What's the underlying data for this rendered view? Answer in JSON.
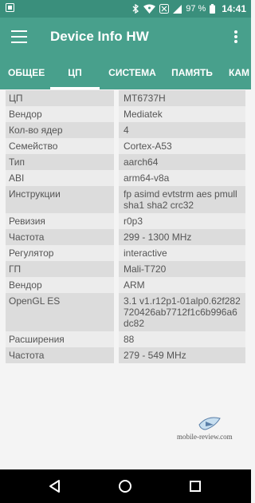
{
  "status_bar": {
    "battery_percent": "97 %",
    "time": "14:41",
    "icons": [
      "notification-icon",
      "bluetooth-icon",
      "wifi-icon",
      "data-off-icon",
      "signal-icon",
      "battery-icon"
    ]
  },
  "app_bar": {
    "title": "Device Info HW",
    "menu_icon": "hamburger-menu-icon",
    "overflow_icon": "more-vertical-icon"
  },
  "tabs": [
    {
      "label": "ОБЩЕЕ",
      "active": false
    },
    {
      "label": "ЦП",
      "active": true
    },
    {
      "label": "СИСТЕМА",
      "active": false
    },
    {
      "label": "ПАМЯТЬ",
      "active": false
    },
    {
      "label": "КАМ",
      "active": false
    }
  ],
  "rows": [
    {
      "key": "ЦП",
      "value": "MT6737H"
    },
    {
      "key": "Вендор",
      "value": "Mediatek"
    },
    {
      "key": "Кол-во ядер",
      "value": "4"
    },
    {
      "key": "Семейство",
      "value": "Cortex-A53"
    },
    {
      "key": "Тип",
      "value": "aarch64"
    },
    {
      "key": "ABI",
      "value": "arm64-v8a"
    },
    {
      "key": "Инструкции",
      "value": "fp asimd evtstrm aes pmull sha1 sha2 crc32"
    },
    {
      "key": "Ревизия",
      "value": "r0p3"
    },
    {
      "key": "Частота",
      "value": "299 - 1300 MHz"
    },
    {
      "key": "Регулятор",
      "value": "interactive"
    },
    {
      "key": "ГП",
      "value": "Mali-T720"
    },
    {
      "key": "Вендор",
      "value": "ARM"
    },
    {
      "key": "OpenGL ES",
      "value": "3.1 v1.r12p1-01alp0.62f282720426ab7712f1c6b996a6dc82"
    },
    {
      "key": "Расширения",
      "value": "88"
    },
    {
      "key": "Частота",
      "value": "279 - 549 MHz"
    }
  ],
  "watermark": {
    "text": "mobile-review.com"
  },
  "colors": {
    "status_bar": "#3a8f7c",
    "app_bar": "#48a08c",
    "row_odd": "#dcdcdc",
    "row_even": "#ececec",
    "background": "#f4f4f4"
  },
  "nav_bar": {
    "icons": [
      "back-icon",
      "home-icon",
      "recents-icon"
    ]
  }
}
